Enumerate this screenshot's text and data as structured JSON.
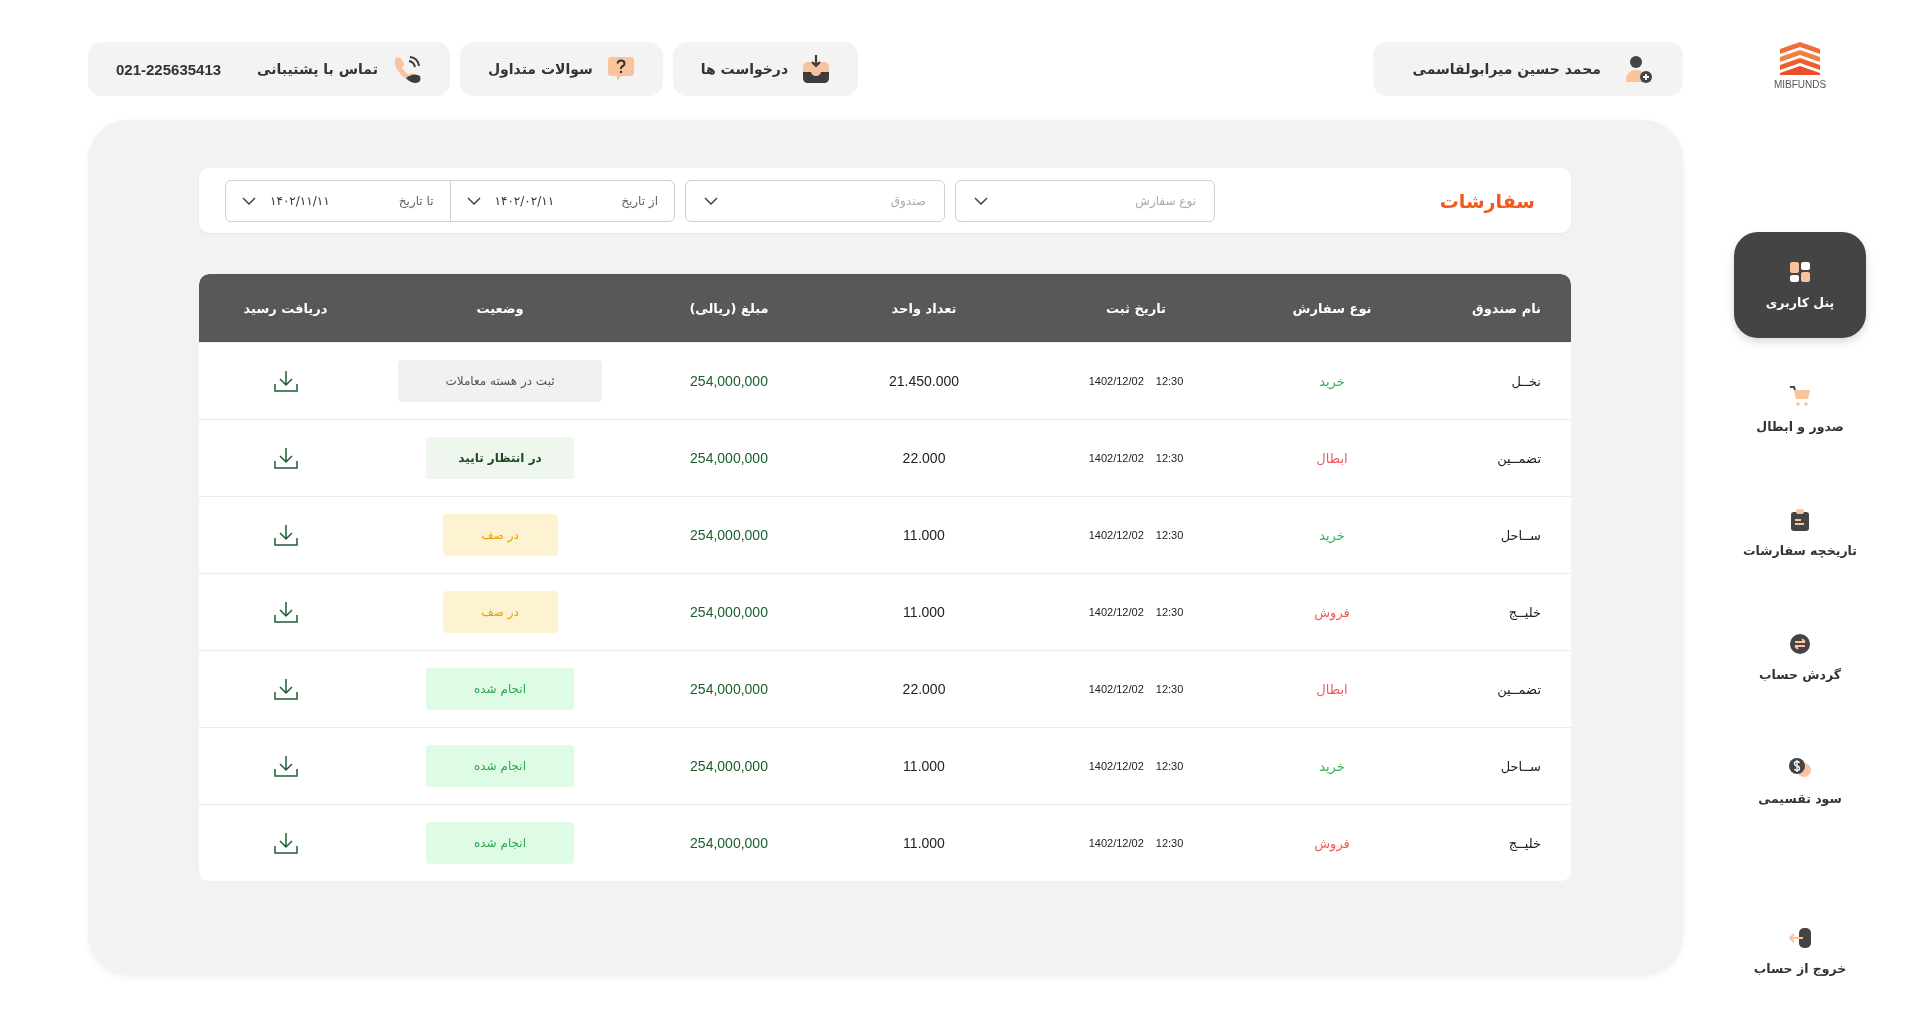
{
  "brand": {
    "name": "MIBFUNDS"
  },
  "user": {
    "name": "محمد حسین میرابولقاسمی"
  },
  "header_buttons": [
    {
      "label": "درخواست ها"
    },
    {
      "label": "سوالات متداول"
    },
    {
      "label": "تماس با پشتیبانی",
      "phone": "021-225635413"
    }
  ],
  "sidebar": {
    "items": [
      {
        "label": "پنل کاربری",
        "selected": true
      },
      {
        "label": "صدور و ابطال",
        "selected": false
      },
      {
        "label": "تاریخچه سفارشات",
        "selected": false
      },
      {
        "label": "گردش حساب",
        "selected": false
      },
      {
        "label": "سود تقسیمی",
        "selected": false
      }
    ],
    "logout": {
      "label": "خروج از حساب"
    }
  },
  "filters": {
    "title": "سفارشات",
    "order_type": {
      "placeholder": "نوع سفارش"
    },
    "fund": {
      "placeholder": "صندوق"
    },
    "from_date": {
      "label": "از تاریخ",
      "value": "۱۴۰۲/۰۲/۱۱"
    },
    "to_date": {
      "label": "تا تاریخ",
      "value": "۱۴۰۲/۱۱/۱۱"
    }
  },
  "table": {
    "columns": [
      "نام صندوق",
      "نوع سفارش",
      "تاریخ ثبت",
      "تعداد واحد",
      "مبلغ (ریالی)",
      "وضعیت",
      "دریافت رسید"
    ],
    "rows": [
      {
        "fund": "نخــل",
        "order_type": {
          "kind": "buy",
          "label": "خرید"
        },
        "time": "12:30",
        "date": "1402/12/02",
        "units": "21.450.000",
        "amount": "254,000,000",
        "status": {
          "kind": "registered",
          "label": "ثبت در هسته معاملات"
        }
      },
      {
        "fund": "تضمــین",
        "order_type": {
          "kind": "cancel",
          "label": "ابطال"
        },
        "time": "12:30",
        "date": "1402/12/02",
        "units": "22.000",
        "amount": "254,000,000",
        "status": {
          "kind": "pending",
          "label": "در انتظار تایید"
        }
      },
      {
        "fund": "ســاحل",
        "order_type": {
          "kind": "buy",
          "label": "خرید"
        },
        "time": "12:30",
        "date": "1402/12/02",
        "units": "11.000",
        "amount": "254,000,000",
        "status": {
          "kind": "queued",
          "label": "در صف"
        }
      },
      {
        "fund": "خلیــج",
        "order_type": {
          "kind": "sell",
          "label": "فروش"
        },
        "time": "12:30",
        "date": "1402/12/02",
        "units": "11.000",
        "amount": "254,000,000",
        "status": {
          "kind": "queued",
          "label": "در صف"
        }
      },
      {
        "fund": "تضمــین",
        "order_type": {
          "kind": "cancel",
          "label": "ابطال"
        },
        "time": "12:30",
        "date": "1402/12/02",
        "units": "22.000",
        "amount": "254,000,000",
        "status": {
          "kind": "done",
          "label": "انجام شده"
        }
      },
      {
        "fund": "ســاحل",
        "order_type": {
          "kind": "buy",
          "label": "خرید"
        },
        "time": "12:30",
        "date": "1402/12/02",
        "units": "11.000",
        "amount": "254,000,000",
        "status": {
          "kind": "done",
          "label": "انجام شده"
        }
      },
      {
        "fund": "خلیــج",
        "order_type": {
          "kind": "sell",
          "label": "فروش"
        },
        "time": "12:30",
        "date": "1402/12/02",
        "units": "11.000",
        "amount": "254,000,000",
        "status": {
          "kind": "done",
          "label": "انجام شده"
        }
      }
    ]
  }
}
